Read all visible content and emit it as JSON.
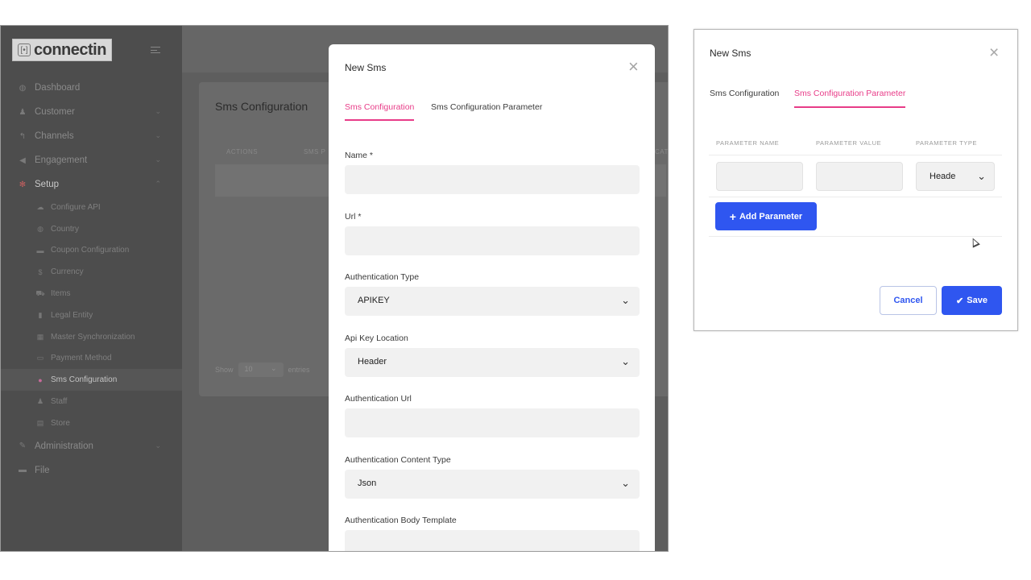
{
  "app": {
    "logo_mark": "[•]",
    "logo_text": "connectin"
  },
  "sidebar": {
    "items": [
      {
        "label": "Dashboard",
        "icon": "dashboard-icon",
        "glyph": "◍"
      },
      {
        "label": "Customer",
        "icon": "user-icon",
        "glyph": "♟",
        "chevron": "⌄"
      },
      {
        "label": "Channels",
        "icon": "reply-icon",
        "glyph": "↰",
        "chevron": "⌄"
      },
      {
        "label": "Engagement",
        "icon": "megaphone-icon",
        "glyph": "◀",
        "chevron": "⌄"
      },
      {
        "label": "Setup",
        "icon": "gear-icon",
        "glyph": "✻",
        "chevron": "⌃"
      }
    ],
    "setup_children": [
      {
        "label": "Configure API",
        "icon": "cloud-icon",
        "glyph": "☁"
      },
      {
        "label": "Country",
        "icon": "globe-icon",
        "glyph": "◍"
      },
      {
        "label": "Coupon Configuration",
        "icon": "envelope-icon",
        "glyph": "▬"
      },
      {
        "label": "Currency",
        "icon": "dollar-icon",
        "glyph": "$"
      },
      {
        "label": "Items",
        "icon": "cart-icon",
        "glyph": "⛟"
      },
      {
        "label": "Legal Entity",
        "icon": "building-icon",
        "glyph": "▮"
      },
      {
        "label": "Master Synchronization",
        "icon": "calendar-icon",
        "glyph": "▦"
      },
      {
        "label": "Payment Method",
        "icon": "card-icon",
        "glyph": "▭"
      },
      {
        "label": "Sms Configuration",
        "icon": "chat-icon",
        "glyph": "●"
      },
      {
        "label": "Staff",
        "icon": "person-icon",
        "glyph": "♟"
      },
      {
        "label": "Store",
        "icon": "store-icon",
        "glyph": "▤"
      }
    ],
    "bottom_items": [
      {
        "label": "Administration",
        "icon": "wrench-icon",
        "glyph": "✎",
        "chevron": "⌄"
      },
      {
        "label": "File",
        "icon": "folder-icon",
        "glyph": "▬"
      }
    ]
  },
  "background_page": {
    "card_title": "Sms Configuration",
    "columns": [
      "ACTIONS",
      "SMS P",
      "CAT"
    ],
    "show_label": "Show",
    "page_size": "10",
    "page_size_chevron": "⌄",
    "entries_label": "entries"
  },
  "modal": {
    "title": "New Sms",
    "close": "×",
    "tabs": [
      "Sms Configuration",
      "Sms Configuration Parameter"
    ],
    "fields": [
      {
        "label": "Name *"
      },
      {
        "label": "Url *"
      },
      {
        "label": "Authentication Type",
        "value": "APIKEY",
        "chevron": "⌄"
      },
      {
        "label": "Api Key Location",
        "value": "Header",
        "chevron": "⌄"
      },
      {
        "label": "Authentication Url"
      },
      {
        "label": "Authentication Content Type",
        "value": "Json",
        "chevron": "⌄"
      },
      {
        "label": "Authentication Body Template"
      }
    ]
  },
  "param_modal": {
    "title": "New Sms",
    "close": "×",
    "tabs": [
      "Sms Configuration",
      "Sms Configuration Parameter"
    ],
    "columns": [
      "PARAMETER NAME",
      "PARAMETER VALUE",
      "PARAMETER TYPE"
    ],
    "row": {
      "name": "",
      "value": "",
      "type": "Heade",
      "chevron": "⌄"
    },
    "add_button": {
      "plus": "+",
      "label": "Add Parameter"
    },
    "cancel_button": "Cancel",
    "save_button": {
      "check": "✔",
      "label": "Save"
    }
  },
  "colors": {
    "accent_pink": "#e83c88",
    "primary_blue": "#2f56f0",
    "overlay_gray": "#5e5e5e"
  }
}
